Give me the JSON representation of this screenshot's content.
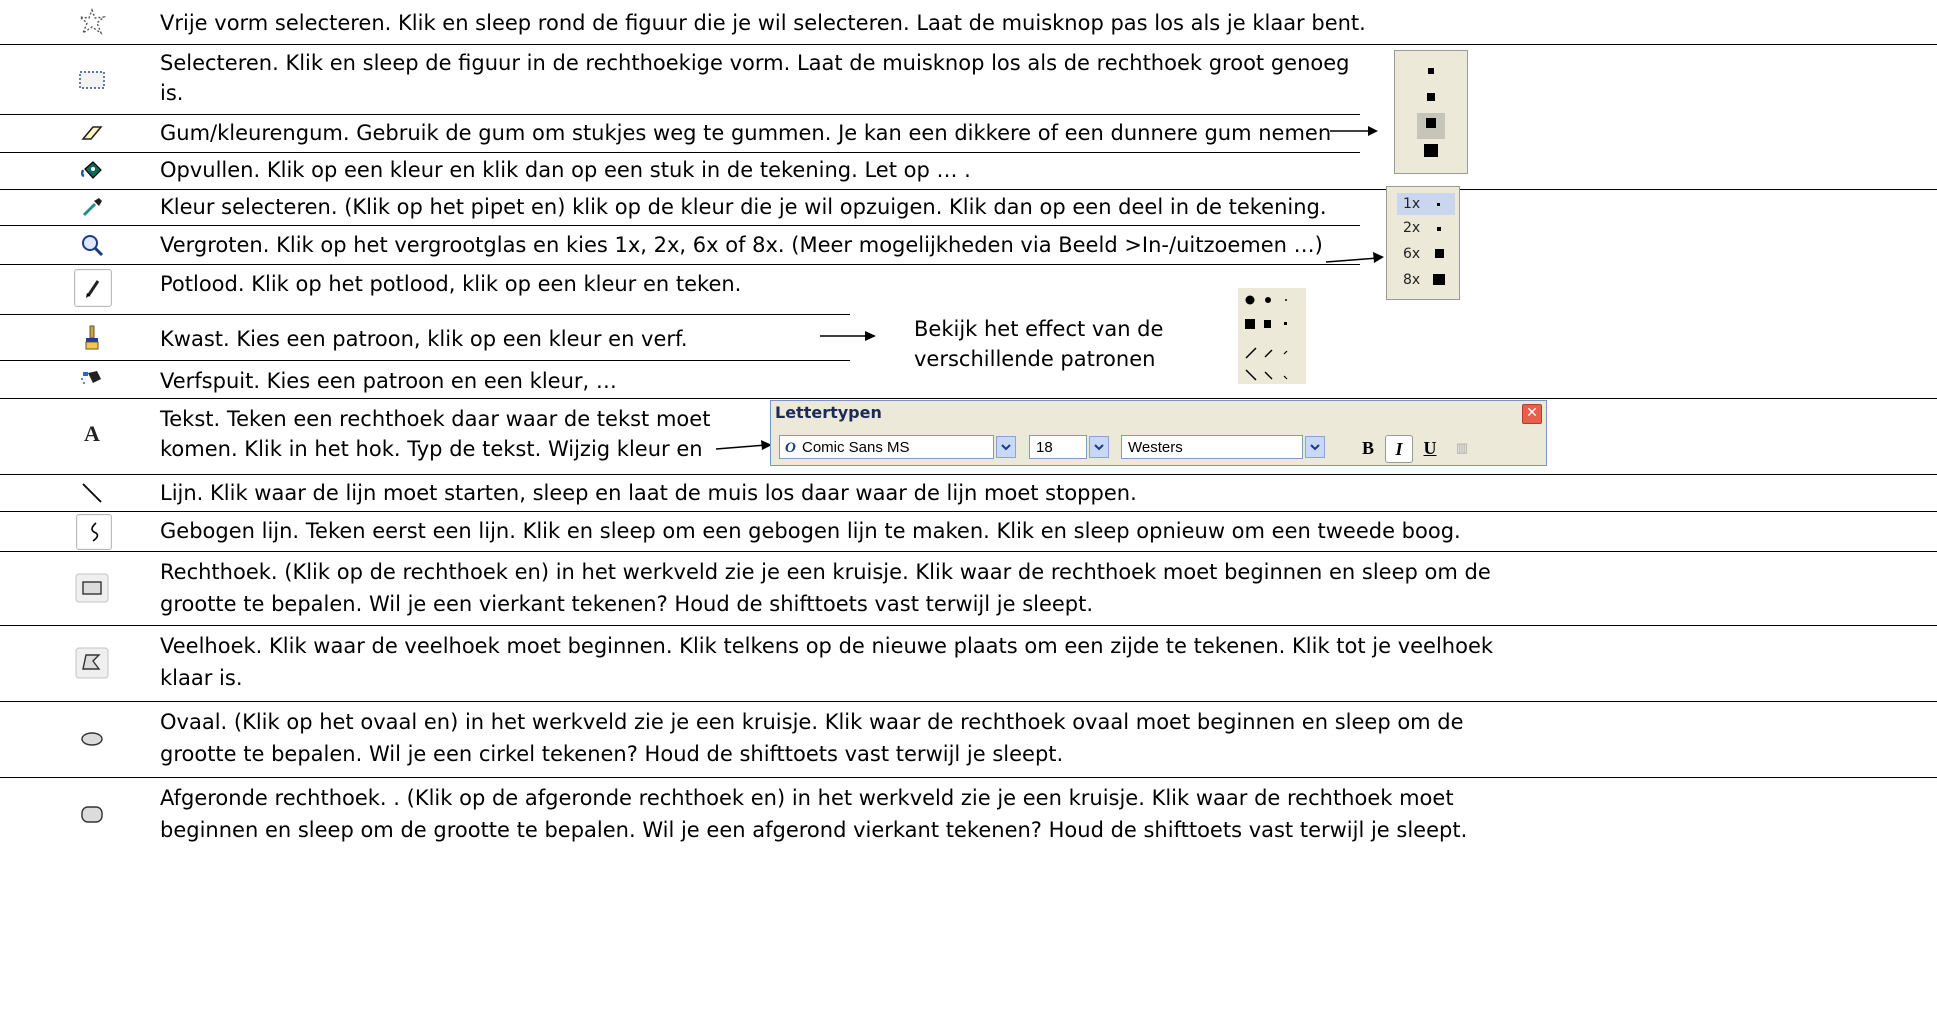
{
  "rows": [
    {
      "icon": "free-form-select-icon",
      "lines": [
        "Vrije vorm selecteren. Klik en sleep rond de figuur die je wil selecteren. Laat de muisknop pas los als je klaar bent."
      ]
    },
    {
      "icon": "rectangle-select-icon",
      "lines": [
        "Selecteren. Klik en sleep de figuur in de rechthoekige vorm. Laat de muisknop los als de rechthoek groot genoeg",
        "is."
      ]
    },
    {
      "icon": "eraser-icon",
      "lines": [
        "Gum/kleurengum. Gebruik de gum om stukjes weg te gummen. Je kan een dikkere of een dunnere gum nemen"
      ]
    },
    {
      "icon": "fill-bucket-icon",
      "lines": [
        "Opvullen. Klik op een kleur en klik dan op een stuk in de tekening. Let op … ."
      ]
    },
    {
      "icon": "color-picker-icon",
      "lines": [
        "Kleur selecteren. (Klik op het pipet en) klik op de kleur die je wil opzuigen. Klik dan op een deel in de tekening."
      ]
    },
    {
      "icon": "magnifier-icon",
      "lines": [
        "Vergroten. Klik op het vergrootglas en kies 1x, 2x, 6x of 8x. (Meer mogelijkheden via Beeld >In-/uitzoemen …)"
      ]
    },
    {
      "icon": "pencil-icon",
      "lines": [
        "Potlood. Klik op het potlood, klik op een kleur en teken."
      ]
    },
    {
      "icon": "brush-icon",
      "lines": [
        "Kwast. Kies een patroon, klik op een kleur en verf."
      ]
    },
    {
      "icon": "airbrush-icon",
      "lines": [
        "Verfspuit. Kies een patroon en een kleur, …"
      ]
    },
    {
      "icon": "text-tool-icon",
      "lines": [
        "Tekst. Teken een rechthoek daar waar de tekst moet",
        "komen. Klik in het hok. Typ de tekst. Wijzig kleur en"
      ]
    },
    {
      "icon": "line-tool-icon",
      "lines": [
        "Lijn. Klik waar de lijn moet starten, sleep en laat de muis los daar waar de lijn moet stoppen."
      ]
    },
    {
      "icon": "curve-tool-icon",
      "lines": [
        "Gebogen lijn. Teken eerst een lijn. Klik en sleep om een gebogen lijn te maken. Klik en sleep opnieuw om een tweede boog."
      ]
    },
    {
      "icon": "rectangle-tool-icon",
      "lines": [
        "Rechthoek. (Klik op de rechthoek en) in het werkveld zie je een kruisje. Klik waar de rechthoek moet beginnen en sleep om de",
        "grootte te bepalen. Wil je een vierkant tekenen? Houd de shifttoets vast terwijl je sleept."
      ]
    },
    {
      "icon": "polygon-tool-icon",
      "lines": [
        "Veelhoek. Klik waar de veelhoek moet beginnen. Klik telkens op de nieuwe plaats om een zijde te tekenen. Klik tot je veelhoek",
        "klaar is."
      ]
    },
    {
      "icon": "ellipse-tool-icon",
      "lines": [
        "Ovaal. (Klik op het ovaal en) in het werkveld zie je een kruisje. Klik waar de rechthoek ovaal moet beginnen en sleep om de",
        "grootte te bepalen. Wil je een cirkel tekenen? Houd de shifttoets vast terwijl je sleept."
      ]
    },
    {
      "icon": "rounded-rectangle-tool-icon",
      "lines": [
        "Afgeronde rechthoek. . (Klik op de afgeronde rechthoek en) in het werkveld zie je een kruisje. Klik waar de rechthoek moet",
        "beginnen en sleep om de grootte te bepalen. Wil je een afgerond vierkant tekenen? Houd de shifttoets vast terwijl je sleept."
      ]
    }
  ],
  "brush_note": [
    "Bekijk het effect van de",
    "verschillende patronen"
  ],
  "zoom_options": [
    "1x",
    "2x",
    "6x",
    "8x"
  ],
  "font_toolbar": {
    "title": "Lettertypen",
    "font_name": "Comic Sans MS",
    "font_size": "18",
    "script": "Westers",
    "bold": "B",
    "italic": "I",
    "underline": "U"
  }
}
